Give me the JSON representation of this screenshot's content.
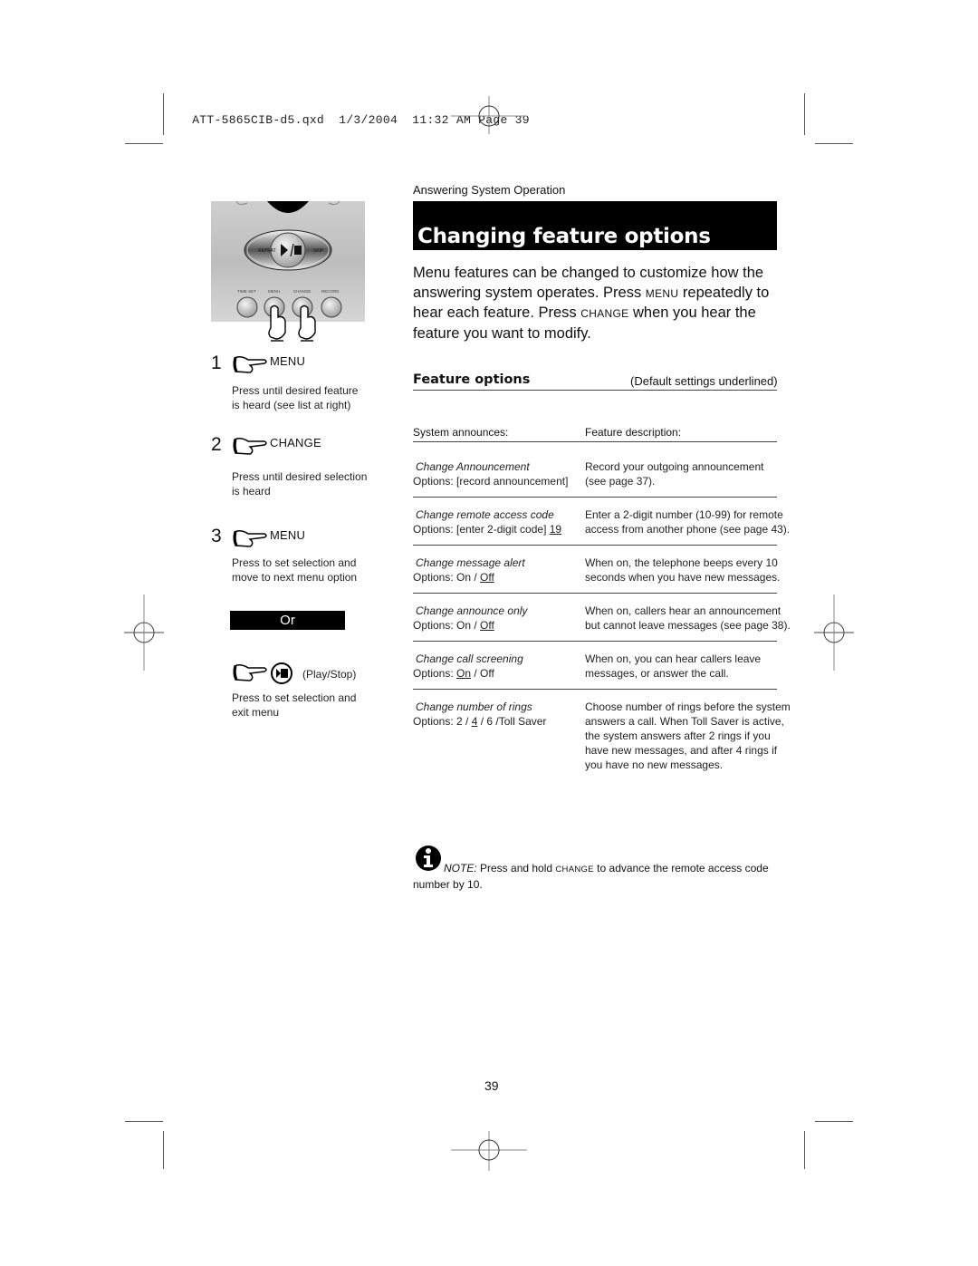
{
  "slug": {
    "filename": "ATT-5865CIB-d5.qxd",
    "date": "1/3/2004",
    "time": "11:32 AM",
    "page_label": "Page 39"
  },
  "device": {
    "top_buttons": [
      "REPEAT",
      "SKIP"
    ],
    "center_button_icon": "play-stop",
    "bottom_buttons": [
      "TIME SET",
      "MENU",
      "CHANGE",
      "RECORD"
    ]
  },
  "steps": [
    {
      "number": "1",
      "key": "MENU",
      "desc_line1": "Press until desired feature",
      "desc_line2": "is heard (see list at right)"
    },
    {
      "number": "2",
      "key": "CHANGE",
      "desc_line1": "Press until desired selection",
      "desc_line2": "is heard"
    },
    {
      "number": "3",
      "key": "MENU",
      "desc_line1": "Press to set selection and",
      "desc_line2": "move  to next menu option"
    }
  ],
  "or_label": "Or",
  "alt_step": {
    "key": "(Play/Stop)",
    "desc_line1": "Press to set selection and",
    "desc_line2": "exit  menu"
  },
  "section_label": "Answering System Operation",
  "title": "Changing feature options",
  "intro": {
    "part1": "Menu features can be changed to customize how the answering system operates. Press ",
    "key1": "MENU",
    "part2": " repeatedly to hear each feature. Press ",
    "key2": "CHANGE",
    "part3": " when you hear the feature you want to modify."
  },
  "feature_options": {
    "heading": "Feature options",
    "default_note": "(Default settings underlined)",
    "col_headers": [
      "System announces:",
      "Feature description:"
    ],
    "rows": [
      {
        "name": "Change Announcement",
        "options_prefix": "Options: [record announcement]",
        "options_default": "",
        "options_suffix": "",
        "desc": [
          "Record your outgoing announcement",
          "(see page 37)."
        ]
      },
      {
        "name": "Change remote access code",
        "options_prefix": "Options: [enter 2-digit code] ",
        "options_default": "19",
        "options_suffix": "",
        "desc": [
          "Enter a 2-digit number (10-99) for remote",
          "access from another phone (see page 43)."
        ]
      },
      {
        "name": "Change message alert",
        "options_prefix": "Options: On / ",
        "options_default": "Off",
        "options_suffix": "",
        "desc": [
          "When on, the telephone beeps every 10",
          "seconds when you have new messages."
        ]
      },
      {
        "name": "Change announce only",
        "options_prefix": "Options: On / ",
        "options_default": "Off",
        "options_suffix": "",
        "desc": [
          "When on, callers hear an announcement",
          "but cannot leave messages (see page 38)."
        ]
      },
      {
        "name": "Change call screening",
        "options_prefix": "Options: ",
        "options_default": "On",
        "options_suffix": " / Off",
        "desc": [
          "When on, you can hear callers leave",
          "messages, or answer the call."
        ]
      },
      {
        "name": "Change number of rings",
        "options_prefix": "Options: 2 / ",
        "options_default": "4",
        "options_suffix": " / 6 /Toll Saver",
        "desc": [
          "Choose number of rings before the system",
          "answers a call. When Toll Saver is active,",
          "the system answers after 2 rings if you",
          "have new messages, and after 4 rings if",
          "you have no new messages."
        ]
      }
    ]
  },
  "note": {
    "label": "NOTE:",
    "text1": " Press and hold ",
    "key": "CHANGE",
    "text2": " to advance the remote access code number by 10."
  },
  "page_number": "39"
}
